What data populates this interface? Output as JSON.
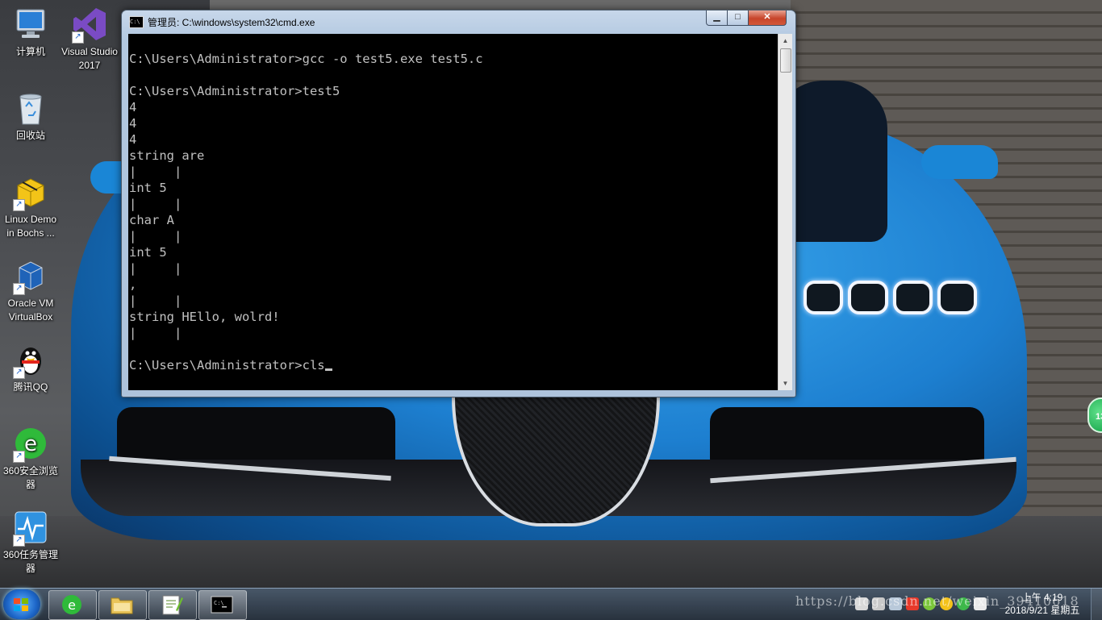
{
  "desktop": {
    "icons": [
      {
        "label": "计算机",
        "icon": "computer-icon"
      },
      {
        "label": "Visual Studio 2017",
        "icon": "visual-studio-icon"
      },
      {
        "label": "回收站",
        "icon": "recycle-bin-icon"
      },
      {
        "label": "Linux Demo in Bochs ...",
        "icon": "linux-demo-icon"
      },
      {
        "label": "Oracle VM VirtualBox",
        "icon": "virtualbox-icon"
      },
      {
        "label": "腾讯QQ",
        "icon": "qq-penguin-icon"
      },
      {
        "label": "360安全浏览器",
        "icon": "360-browser-icon"
      },
      {
        "label": "360任务管理器",
        "icon": "360-task-manager-icon"
      }
    ],
    "side_badge": "13"
  },
  "window": {
    "title": "管理员: C:\\windows\\system32\\cmd.exe",
    "title_icon_text": "C:\\",
    "controls": {
      "minimize": "▁",
      "maximize": "□",
      "close": "✕"
    },
    "console_lines": [
      "C:\\Users\\Administrator>gcc -o test5.exe test5.c",
      "",
      "C:\\Users\\Administrator>test5",
      "4",
      "4",
      "4",
      "string are",
      "|     |",
      "int 5",
      "|     |",
      "char A",
      "|     |",
      "int 5",
      "|     |",
      ",",
      "|     |",
      "string HEllo, wolrd!",
      "|     |",
      "",
      "C:\\Users\\Administrator>cls"
    ]
  },
  "taskbar": {
    "pinned": [
      {
        "name": "360-browser-taskbar-button",
        "icon": "360-browser-icon"
      },
      {
        "name": "file-explorer-taskbar-button",
        "icon": "folder-icon"
      },
      {
        "name": "notepad-plus-taskbar-button",
        "icon": "notepad-plus-icon"
      },
      {
        "name": "cmd-taskbar-button",
        "icon": "cmd-icon"
      }
    ],
    "clock": {
      "time": "上午 4:19",
      "date": "2018/9/21 星期五"
    },
    "watermark": "https://blog.csdn.net/weixin_39410618"
  },
  "colors": {
    "console_bg": "#000000",
    "console_fg": "#c0c0c0",
    "close_red": "#c7442a",
    "car_blue": "#1d7fd0"
  }
}
